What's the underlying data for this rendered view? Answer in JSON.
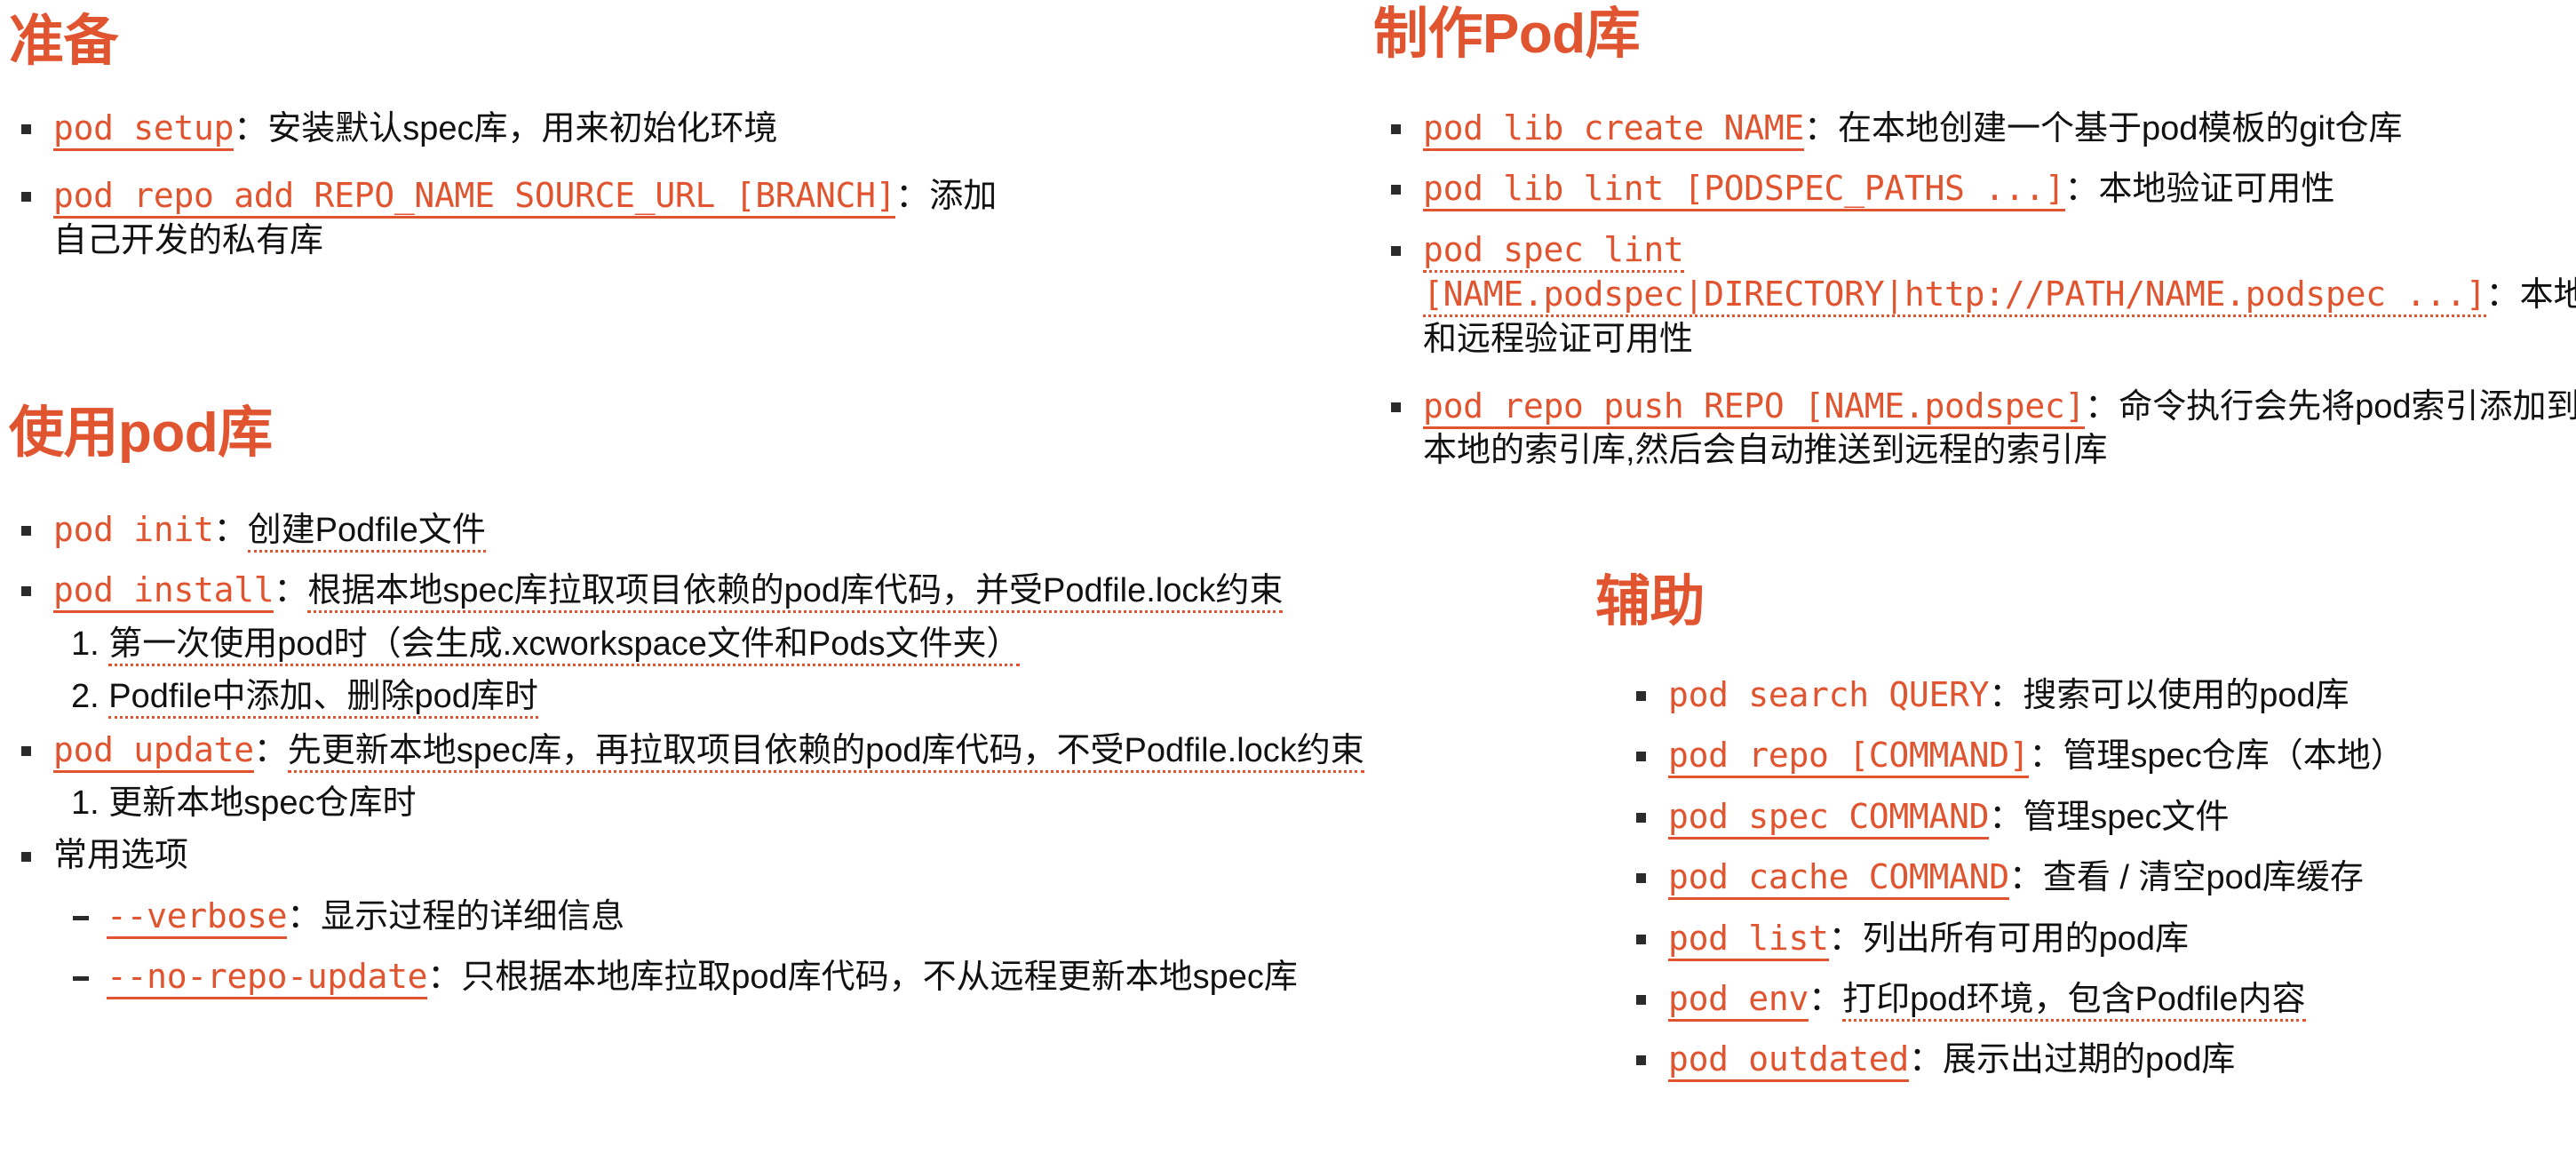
{
  "meta": {
    "accent_color": "#e0542f",
    "text_color": "#111111",
    "background_color": "#ffffff"
  },
  "sections": {
    "prepare": {
      "heading": "准备",
      "items": [
        {
          "cmd": "pod setup",
          "sep": "：",
          "desc": "安装默认spec库，用来初始化环境"
        },
        {
          "cmd": "pod repo add REPO_NAME SOURCE_URL [BRANCH]",
          "sep": "：",
          "desc": "添加自己开发的私有库"
        }
      ]
    },
    "use_pod": {
      "heading": "使用pod库",
      "items": [
        {
          "cmd": "pod init",
          "sep": "：",
          "desc": "创建Podfile文件"
        },
        {
          "cmd": "pod install",
          "sep": "：",
          "desc": "根据本地spec库拉取项目依赖的pod库代码，并受Podfile.lock约束"
        },
        {
          "num": "1.",
          "desc": "第一次使用pod时（会生成.xcworkspace文件和Pods文件夹）"
        },
        {
          "num": "2.",
          "desc": "Podfile中添加、删除pod库时"
        },
        {
          "cmd": "pod update",
          "sep": "：",
          "desc": "先更新本地spec库，再拉取项目依赖的pod库代码，不受Podfile.lock约束"
        },
        {
          "num": "1.",
          "desc": "更新本地spec仓库时"
        },
        {
          "desc": "常用选项"
        },
        {
          "level": 3,
          "cmd": "--verbose",
          "sep": "：",
          "desc": "显示过程的详细信息"
        },
        {
          "level": 3,
          "cmd": "--no-repo-update",
          "sep": "：",
          "desc": "只根据本地库拉取pod库代码，不从远程更新本地spec库"
        }
      ]
    },
    "make_pod": {
      "heading": "制作Pod库",
      "items": [
        {
          "cmd": "pod lib create NAME",
          "sep": "：",
          "desc": "在本地创建一个基于pod模板的git仓库"
        },
        {
          "cmd": "pod lib lint [PODSPEC_PATHS ...]",
          "sep": "：",
          "desc": "本地验证可用性"
        },
        {
          "cmd": "pod spec lint [NAME.podspec|DIRECTORY|http://PATH/NAME.podspec ...]",
          "sep": "：",
          "desc": "本地和远程验证可用性"
        },
        {
          "cmd": "pod repo push REPO [NAME.podspec]",
          "sep": "：",
          "desc": "命令执行会先将pod索引添加到本地的索引库,然后会自动推送到远程的索引库"
        }
      ]
    },
    "helper": {
      "heading": "辅助",
      "items": [
        {
          "cmd": "pod search QUERY",
          "sep": "：",
          "desc": "搜索可以使用的pod库"
        },
        {
          "cmd": "pod repo [COMMAND]",
          "sep": "：",
          "desc": "管理spec仓库（本地）"
        },
        {
          "cmd": "pod spec COMMAND",
          "sep": "：",
          "desc": "管理spec文件"
        },
        {
          "cmd": "pod cache COMMAND",
          "sep": "：",
          "desc": "查看 / 清空pod库缓存"
        },
        {
          "cmd": "pod list",
          "sep": "：",
          "desc": "列出所有可用的pod库"
        },
        {
          "cmd": "pod env",
          "sep": "：",
          "desc": "打印pod环境，包含Podfile内容"
        },
        {
          "cmd": "pod outdated",
          "sep": "：",
          "desc": "展示出过期的pod库"
        }
      ]
    }
  }
}
